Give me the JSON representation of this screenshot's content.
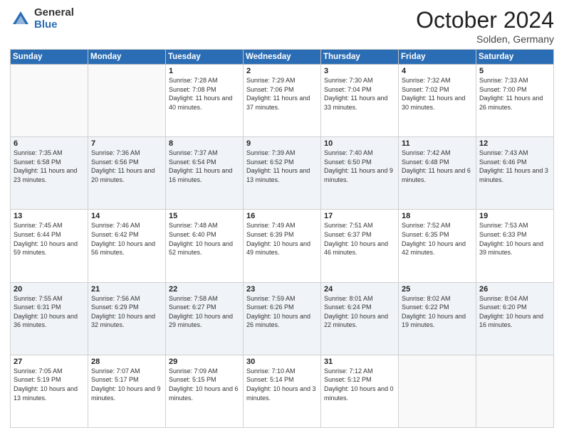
{
  "header": {
    "logo_general": "General",
    "logo_blue": "Blue",
    "title": "October 2024",
    "location": "Solden, Germany"
  },
  "days_of_week": [
    "Sunday",
    "Monday",
    "Tuesday",
    "Wednesday",
    "Thursday",
    "Friday",
    "Saturday"
  ],
  "weeks": [
    [
      {
        "day": "",
        "info": ""
      },
      {
        "day": "",
        "info": ""
      },
      {
        "day": "1",
        "info": "Sunrise: 7:28 AM\nSunset: 7:08 PM\nDaylight: 11 hours and 40 minutes."
      },
      {
        "day": "2",
        "info": "Sunrise: 7:29 AM\nSunset: 7:06 PM\nDaylight: 11 hours and 37 minutes."
      },
      {
        "day": "3",
        "info": "Sunrise: 7:30 AM\nSunset: 7:04 PM\nDaylight: 11 hours and 33 minutes."
      },
      {
        "day": "4",
        "info": "Sunrise: 7:32 AM\nSunset: 7:02 PM\nDaylight: 11 hours and 30 minutes."
      },
      {
        "day": "5",
        "info": "Sunrise: 7:33 AM\nSunset: 7:00 PM\nDaylight: 11 hours and 26 minutes."
      }
    ],
    [
      {
        "day": "6",
        "info": "Sunrise: 7:35 AM\nSunset: 6:58 PM\nDaylight: 11 hours and 23 minutes."
      },
      {
        "day": "7",
        "info": "Sunrise: 7:36 AM\nSunset: 6:56 PM\nDaylight: 11 hours and 20 minutes."
      },
      {
        "day": "8",
        "info": "Sunrise: 7:37 AM\nSunset: 6:54 PM\nDaylight: 11 hours and 16 minutes."
      },
      {
        "day": "9",
        "info": "Sunrise: 7:39 AM\nSunset: 6:52 PM\nDaylight: 11 hours and 13 minutes."
      },
      {
        "day": "10",
        "info": "Sunrise: 7:40 AM\nSunset: 6:50 PM\nDaylight: 11 hours and 9 minutes."
      },
      {
        "day": "11",
        "info": "Sunrise: 7:42 AM\nSunset: 6:48 PM\nDaylight: 11 hours and 6 minutes."
      },
      {
        "day": "12",
        "info": "Sunrise: 7:43 AM\nSunset: 6:46 PM\nDaylight: 11 hours and 3 minutes."
      }
    ],
    [
      {
        "day": "13",
        "info": "Sunrise: 7:45 AM\nSunset: 6:44 PM\nDaylight: 10 hours and 59 minutes."
      },
      {
        "day": "14",
        "info": "Sunrise: 7:46 AM\nSunset: 6:42 PM\nDaylight: 10 hours and 56 minutes."
      },
      {
        "day": "15",
        "info": "Sunrise: 7:48 AM\nSunset: 6:40 PM\nDaylight: 10 hours and 52 minutes."
      },
      {
        "day": "16",
        "info": "Sunrise: 7:49 AM\nSunset: 6:39 PM\nDaylight: 10 hours and 49 minutes."
      },
      {
        "day": "17",
        "info": "Sunrise: 7:51 AM\nSunset: 6:37 PM\nDaylight: 10 hours and 46 minutes."
      },
      {
        "day": "18",
        "info": "Sunrise: 7:52 AM\nSunset: 6:35 PM\nDaylight: 10 hours and 42 minutes."
      },
      {
        "day": "19",
        "info": "Sunrise: 7:53 AM\nSunset: 6:33 PM\nDaylight: 10 hours and 39 minutes."
      }
    ],
    [
      {
        "day": "20",
        "info": "Sunrise: 7:55 AM\nSunset: 6:31 PM\nDaylight: 10 hours and 36 minutes."
      },
      {
        "day": "21",
        "info": "Sunrise: 7:56 AM\nSunset: 6:29 PM\nDaylight: 10 hours and 32 minutes."
      },
      {
        "day": "22",
        "info": "Sunrise: 7:58 AM\nSunset: 6:27 PM\nDaylight: 10 hours and 29 minutes."
      },
      {
        "day": "23",
        "info": "Sunrise: 7:59 AM\nSunset: 6:26 PM\nDaylight: 10 hours and 26 minutes."
      },
      {
        "day": "24",
        "info": "Sunrise: 8:01 AM\nSunset: 6:24 PM\nDaylight: 10 hours and 22 minutes."
      },
      {
        "day": "25",
        "info": "Sunrise: 8:02 AM\nSunset: 6:22 PM\nDaylight: 10 hours and 19 minutes."
      },
      {
        "day": "26",
        "info": "Sunrise: 8:04 AM\nSunset: 6:20 PM\nDaylight: 10 hours and 16 minutes."
      }
    ],
    [
      {
        "day": "27",
        "info": "Sunrise: 7:05 AM\nSunset: 5:19 PM\nDaylight: 10 hours and 13 minutes."
      },
      {
        "day": "28",
        "info": "Sunrise: 7:07 AM\nSunset: 5:17 PM\nDaylight: 10 hours and 9 minutes."
      },
      {
        "day": "29",
        "info": "Sunrise: 7:09 AM\nSunset: 5:15 PM\nDaylight: 10 hours and 6 minutes."
      },
      {
        "day": "30",
        "info": "Sunrise: 7:10 AM\nSunset: 5:14 PM\nDaylight: 10 hours and 3 minutes."
      },
      {
        "day": "31",
        "info": "Sunrise: 7:12 AM\nSunset: 5:12 PM\nDaylight: 10 hours and 0 minutes."
      },
      {
        "day": "",
        "info": ""
      },
      {
        "day": "",
        "info": ""
      }
    ]
  ]
}
